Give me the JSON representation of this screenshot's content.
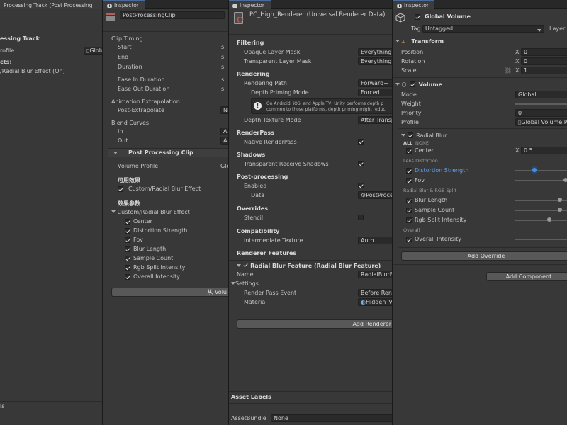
{
  "panel1": {
    "tab_title": "Processing Track (Post Processing",
    "header": "essing Track",
    "profile_label": "rofile",
    "profile_value": "Glob",
    "effects_label": "cts:",
    "effect_item": "/Radial Blur Effect (On)",
    "footer_label": "ls"
  },
  "panel2": {
    "tab_title": "Inspector",
    "object_name": "PostProcessingClip",
    "clip_timing": "Clip Timing",
    "start": "Start",
    "end": "End",
    "duration": "Duration",
    "ease_in": "Ease In Duration",
    "ease_out": "Ease Out Duration",
    "unit": "s",
    "anim_extrap": "Animation Extrapolation",
    "post_extrap": "Post-Extrapolate",
    "post_extrap_value": "No",
    "blend_curves": "Blend Curves",
    "in": "In",
    "out": "Out",
    "curve_value": "Au",
    "ppc_header": "Post Processing Clip",
    "volume_profile": "Volume Profile",
    "volume_profile_value": "Glo",
    "available_effects": "可用效果",
    "effect_option": "Custom/Radial Blur Effect",
    "effect_params": "效果参数",
    "effect_group": "Custom/Radial Blur Effect",
    "params": [
      "Center",
      "Distortion Strength",
      "Fov",
      "Blur Length",
      "Sample Count",
      "Rgb Split Intensity",
      "Overall Intensity"
    ],
    "button_label": "从 Volu"
  },
  "panel3": {
    "tab_title": "Inspector",
    "object_name": "PC_High_Renderer (Universal Renderer Data)",
    "filtering": "Filtering",
    "opaque_mask": "Opaque Layer Mask",
    "transparent_mask": "Transparent Layer Mask",
    "everything": "Everything",
    "rendering": "Rendering",
    "rendering_path": "Rendering Path",
    "rendering_path_value": "Forward+",
    "depth_priming": "Depth Priming Mode",
    "depth_priming_value": "Forced",
    "info_line1": "On Android, iOS, and Apple TV, Unity performs depth p",
    "info_line2": "common to those platforms, depth priming might reduc",
    "depth_texture": "Depth Texture Mode",
    "depth_texture_value": "After Transp",
    "renderpass": "RenderPass",
    "native_renderpass": "Native RenderPass",
    "shadows": "Shadows",
    "transparent_shadows": "Transparent Receive Shadows",
    "post_processing": "Post-processing",
    "enabled": "Enabled",
    "data": "Data",
    "data_value": "PostProce",
    "overrides": "Overrides",
    "stencil": "Stencil",
    "compatibility": "Compatibility",
    "intermediate": "Intermediate Texture",
    "intermediate_value": "Auto",
    "renderer_features": "Renderer Features",
    "feature_header": "Radial Blur Feature (Radial Blur Feature)",
    "name": "Name",
    "name_value": "RadialBlurFe",
    "settings": "Settings",
    "render_pass_event": "Render Pass Event",
    "render_pass_event_value": "Before Rend",
    "material": "Material",
    "material_value": "Hidden_Va",
    "add_renderer": "Add Renderer",
    "asset_labels": "Asset Labels",
    "asset_bundle": "AssetBundle",
    "asset_bundle_value": "None"
  },
  "panel4": {
    "tab_title": "Inspector",
    "object_name": "Global Volume",
    "tag_label": "Tag",
    "tag_value": "Untagged",
    "layer_label": "Layer",
    "transform": "Transform",
    "position": "Position",
    "rotation": "Rotation",
    "scale": "Scale",
    "x": "X",
    "pos_x": "0",
    "rot_x": "0",
    "scale_x": "1",
    "volume": "Volume",
    "mode": "Mode",
    "mode_value": "Global",
    "weight": "Weight",
    "priority": "Priority",
    "priority_value": "0",
    "profile": "Profile",
    "profile_value": "Global Volume P",
    "radial_blur": "Radial Blur",
    "all": "ALL",
    "none": "NONE",
    "center": "Center",
    "center_x": "0.5",
    "lens_distortion": "Lens Distortion",
    "distortion_strength": "Distortion Strength",
    "fov": "Fov",
    "radial_rgb": "Radial Blur & RGB Split",
    "blur_length": "Blur Length",
    "sample_count": "Sample Count",
    "rgb_split": "Rgb Split Intensity",
    "overall": "Overall",
    "overall_intensity": "Overall Intensity",
    "add_override": "Add Override",
    "add_component": "Add Component"
  }
}
